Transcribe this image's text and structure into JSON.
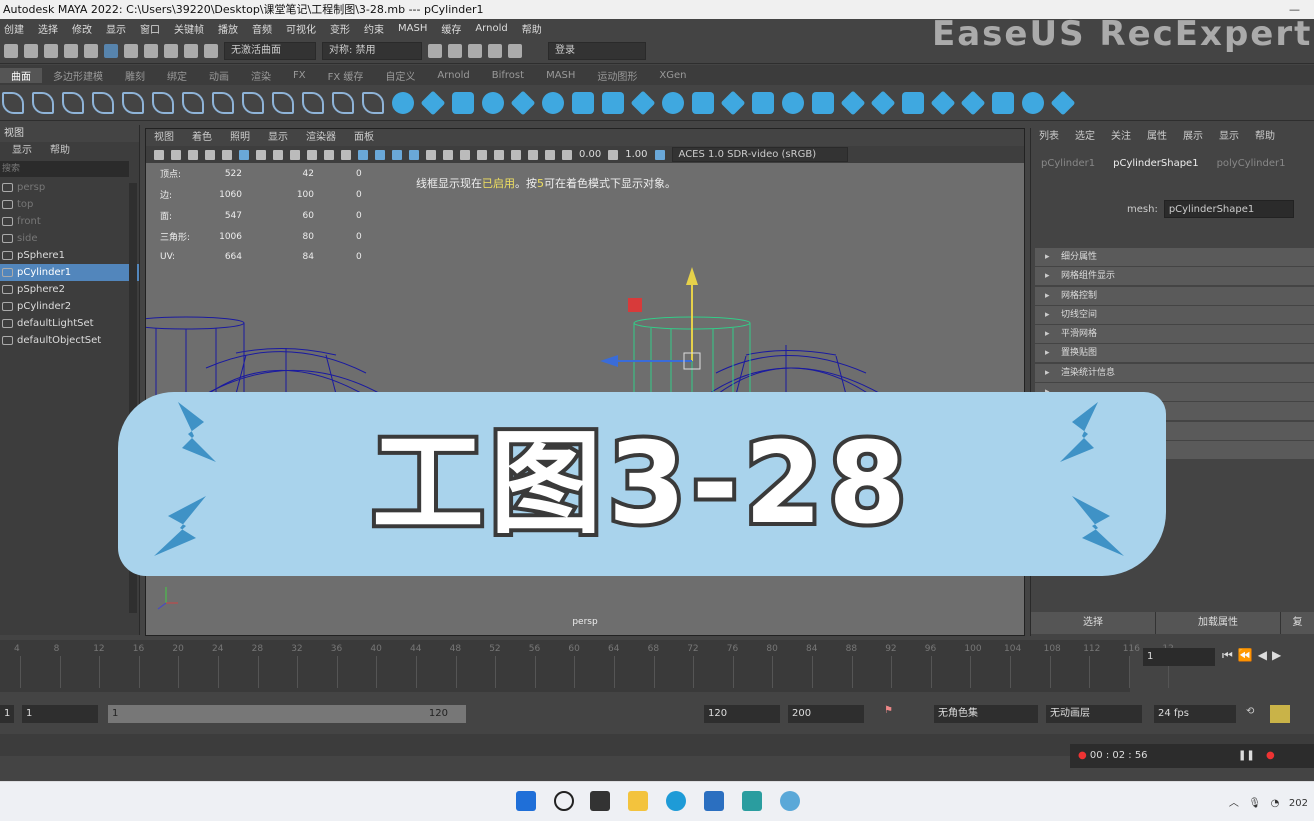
{
  "window": {
    "title": "Autodesk MAYA 2022: C:\\Users\\39220\\Desktop\\课堂笔记\\工程制图\\3-28.mb  ---  pCylinder1",
    "controls": "—"
  },
  "menubar": [
    "创建",
    "选择",
    "修改",
    "显示",
    "窗口",
    "关键帧",
    "播放",
    "音频",
    "可视化",
    "变形",
    "约束",
    "MASH",
    "缓存",
    "Arnold",
    "帮助"
  ],
  "statusline": {
    "live_label": "无激活曲面",
    "symmetry_label": "对称: 禁用",
    "login_label": "登录",
    "zoom_a": "0.00",
    "zoom_b": "1.00",
    "colorspace": "ACES 1.0 SDR-video (sRGB)"
  },
  "shelf_tabs": [
    "曲面",
    "多边形建模",
    "雕刻",
    "绑定",
    "动画",
    "渲染",
    "FX",
    "FX 缓存",
    "自定义",
    "Arnold",
    "Bifrost",
    "MASH",
    "运动图形",
    "XGen"
  ],
  "outliner": {
    "header": "视图",
    "menu": [
      "显示",
      "帮助"
    ],
    "search": "搜索",
    "items": [
      {
        "label": "persp",
        "state": "dim"
      },
      {
        "label": "top",
        "state": "dim"
      },
      {
        "label": "front",
        "state": "dim"
      },
      {
        "label": "side",
        "state": "dim"
      },
      {
        "label": "pSphere1",
        "state": "normal"
      },
      {
        "label": "pCylinder1",
        "state": "selected"
      },
      {
        "label": "pSphere2",
        "state": "normal"
      },
      {
        "label": "pCylinder2",
        "state": "normal"
      },
      {
        "label": "defaultLightSet",
        "state": "normal"
      },
      {
        "label": "defaultObjectSet",
        "state": "normal"
      }
    ]
  },
  "viewport": {
    "menu": [
      "视图",
      "着色",
      "照明",
      "显示",
      "渲染器",
      "面板"
    ],
    "hud": [
      {
        "k": "顶点:",
        "a": "522",
        "b": "42",
        "c": "0"
      },
      {
        "k": "边:",
        "a": "1060",
        "b": "100",
        "c": "0"
      },
      {
        "k": "面:",
        "a": "547",
        "b": "60",
        "c": "0"
      },
      {
        "k": "三角形:",
        "a": "1006",
        "b": "80",
        "c": "0"
      },
      {
        "k": "UV:",
        "a": "664",
        "b": "84",
        "c": "0"
      }
    ],
    "hint_pre": "线框显示现在",
    "hint_hl": "已启用",
    "hint_mid": "。按",
    "hint_key": "5",
    "hint_post": "可在着色模式下显示对象。",
    "camera": "persp"
  },
  "attr": {
    "menu": [
      "列表",
      "选定",
      "关注",
      "属性",
      "展示",
      "显示",
      "帮助"
    ],
    "tabs": [
      "pCylinder1",
      "pCylinderShape1",
      "polyCylinder1"
    ],
    "active_tab": "pCylinderShape1",
    "mesh_label": "mesh:",
    "mesh_value": "pCylinderShape1",
    "sections": [
      "细分属性",
      "网格组件显示",
      "网格控制",
      "切线空间",
      "平滑网格",
      "置换贴图",
      "渲染统计信息"
    ],
    "buttons": [
      "选择",
      "加载属性",
      "复"
    ]
  },
  "timeline": {
    "ticks": [
      "4",
      "8",
      "12",
      "16",
      "20",
      "24",
      "28",
      "32",
      "36",
      "40",
      "44",
      "48",
      "52",
      "56",
      "60",
      "64",
      "68",
      "72",
      "76",
      "80",
      "84",
      "88",
      "92",
      "96",
      "100",
      "104",
      "108",
      "112",
      "116",
      "12"
    ],
    "current_frame": "1"
  },
  "range": {
    "start": "1",
    "inner_start": "1",
    "slider_a": "1",
    "slider_b": "120",
    "end": "120",
    "anim_end": "200",
    "char_set": "无角色集",
    "anim_layer": "无动画层",
    "fps": "24 fps"
  },
  "recorder": {
    "time": "00 : 02 : 56"
  },
  "overlay": {
    "title": "工图3-28",
    "watermark": "EaseUS RecExperts"
  },
  "tray": {
    "date": "202"
  },
  "colors": {
    "banner": "#a9d3ec",
    "bolt": "#3f92c6",
    "selected": "#5286bc"
  }
}
